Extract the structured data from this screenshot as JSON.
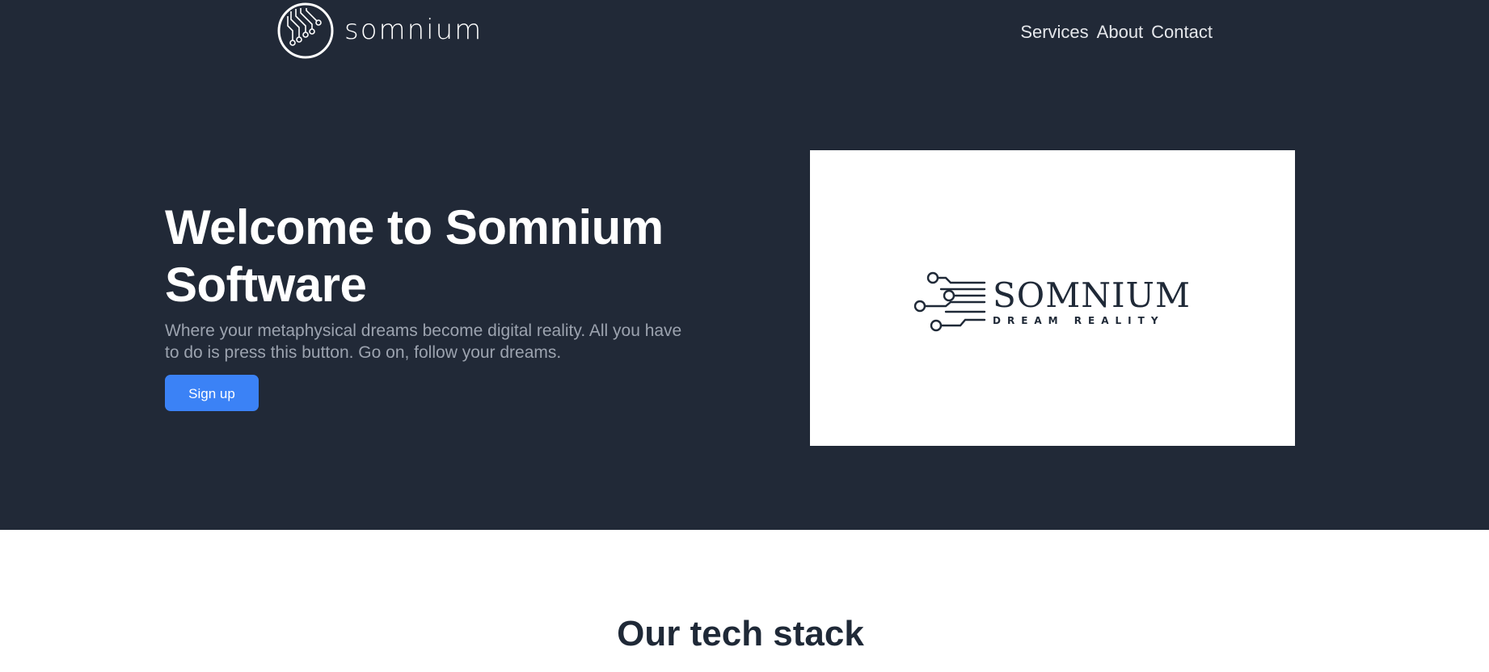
{
  "brand": {
    "name": "somnium",
    "logo_icon": "circuit-circle-icon"
  },
  "nav": {
    "items": [
      {
        "label": "Services"
      },
      {
        "label": "About"
      },
      {
        "label": "Contact"
      }
    ]
  },
  "hero": {
    "title": "Welcome to Somnium Software",
    "subtitle": "Where your metaphysical dreams become digital reality. All you have to do is press this button. Go on, follow your dreams.",
    "cta_label": "Sign up",
    "image": {
      "logo_name": "SOMNIUM",
      "logo_tagline": "DREAM REALITY",
      "logo_icon": "circuit-lines-icon"
    }
  },
  "stack": {
    "title": "Our tech stack"
  },
  "colors": {
    "hero_bg": "#212937",
    "accent": "#3b82f6",
    "heading_dark": "#1f2937",
    "muted_text": "#9ca3af"
  }
}
